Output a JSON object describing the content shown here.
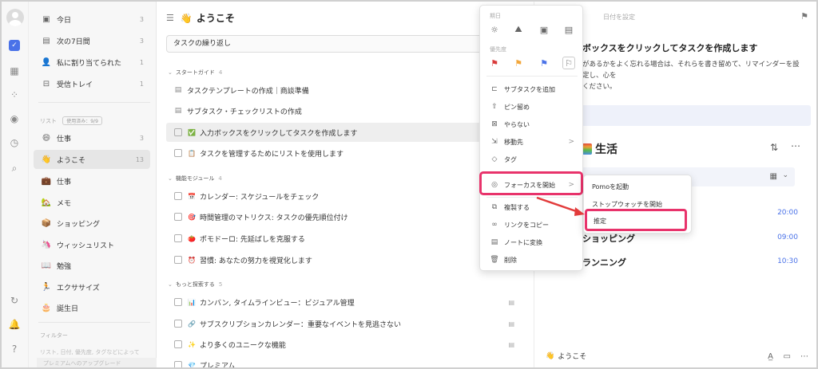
{
  "sidebar": {
    "smart_lists": [
      {
        "label": "今日",
        "count": "3",
        "icon": "calendar-today-icon"
      },
      {
        "label": "次の7日間",
        "count": "3",
        "icon": "calendar-week-icon"
      },
      {
        "label": "私に割り当てられた",
        "count": "1",
        "icon": "user-icon"
      },
      {
        "label": "受信トレイ",
        "count": "1",
        "icon": "inbox-icon"
      }
    ],
    "lists_header": "リスト",
    "lists_badge": "使用済み：9/9",
    "lists": [
      {
        "label": "仕事",
        "count": "3",
        "emoji": "😄"
      },
      {
        "label": "ようこそ",
        "count": "13",
        "emoji": "👋"
      },
      {
        "label": "仕事",
        "count": "",
        "emoji": "💼"
      },
      {
        "label": "メモ",
        "count": "",
        "emoji": "🏡"
      },
      {
        "label": "ショッピング",
        "count": "",
        "emoji": "📦"
      },
      {
        "label": "ウィッシュリスト",
        "count": "",
        "emoji": "🦄"
      },
      {
        "label": "勉強",
        "count": "",
        "emoji": "📖"
      },
      {
        "label": "エクササイズ",
        "count": "",
        "emoji": "🏃"
      },
      {
        "label": "誕生日",
        "count": "",
        "emoji": "🎂"
      }
    ],
    "filter_header": "フィルター",
    "filter_placeholder": "リスト, 日付, 優先度, タグなどによって",
    "upgrade_label": "プレミアムへのアップグレード"
  },
  "main": {
    "title": "ようこそ",
    "title_emoji": "👋",
    "add_placeholder": "タスクの繰り返し",
    "sections": [
      {
        "label": "スタートガイド",
        "count": "4"
      },
      {
        "label": "機能モジュール",
        "count": "4"
      },
      {
        "label": "もっと探索する",
        "count": "5"
      }
    ],
    "tasks_guide": [
      {
        "label": "タスクテンプレートの作成｜商談準備",
        "emoji": ""
      },
      {
        "label": "サブタスク・チェックリストの作成",
        "emoji": ""
      },
      {
        "label": "入力ボックスをクリックしてタスクを作成します",
        "emoji": "✅"
      },
      {
        "label": "タスクを管理するためにリストを使用します",
        "emoji": "📋"
      }
    ],
    "tasks_feature": [
      {
        "label": "カレンダー: スケジュールをチェック",
        "emoji": "📅"
      },
      {
        "label": "時間管理のマトリクス: タスクの優先順位付け",
        "emoji": "🎯"
      },
      {
        "label": "ポモドーロ: 先延ばしを克服する",
        "emoji": "🍅"
      },
      {
        "label": "習慣: あなたの努力を視覚化します",
        "emoji": "⏰"
      }
    ],
    "tasks_explore": [
      {
        "label": "カンバン, タイムラインビュー：ビジュアル管理",
        "emoji": "📊"
      },
      {
        "label": "サブスクリプションカレンダー：重要なイベントを見逃さない",
        "emoji": "🔗"
      },
      {
        "label": "より多くのユニークな機能",
        "emoji": "✨"
      },
      {
        "label": "プレミアム",
        "emoji": "💎"
      }
    ]
  },
  "context_menu": {
    "date_label": "期日",
    "priority_label": "優先度",
    "items": [
      {
        "label": "サブタスクを追加",
        "icon": "subtask-icon"
      },
      {
        "label": "ピン留め",
        "icon": "pin-icon"
      },
      {
        "label": "やらない",
        "icon": "x-box-icon"
      },
      {
        "label": "移動先",
        "icon": "move-icon",
        "arrow": ">"
      },
      {
        "label": "タグ",
        "icon": "tag-icon"
      },
      {
        "label": "フォーカスを開始",
        "icon": "focus-icon",
        "arrow": ">"
      },
      {
        "label": "複製する",
        "icon": "duplicate-icon"
      },
      {
        "label": "リンクをコピー",
        "icon": "link-icon"
      },
      {
        "label": "ノートに変換",
        "icon": "note-icon"
      },
      {
        "label": "削除",
        "icon": "trash-icon"
      }
    ],
    "priority_colors": [
      "#d93a3a",
      "#f2a63a",
      "#4a72e8",
      "#777777"
    ]
  },
  "submenu": {
    "items": [
      "Pomoを起動",
      "ストップウォッチを開始",
      "推定"
    ]
  },
  "detail": {
    "date_placeholder": "日付を設定",
    "title": "ボックスをクリックしてタスクを作成します",
    "desc": "があるかをよく忘れる場合は、それらを書き留めて、リマインダーを設定し、心を\nください。",
    "life_title": "生活",
    "rows": [
      {
        "label": "",
        "time": "20:00"
      },
      {
        "label": "ショッピング",
        "time": "09:00"
      },
      {
        "label": "ランニング",
        "time": "10:30"
      }
    ],
    "footer_list": "ようこそ",
    "footer_emoji": "👋"
  },
  "colors": {
    "accent": "#4a72e8",
    "highlight": "#e8336b"
  }
}
